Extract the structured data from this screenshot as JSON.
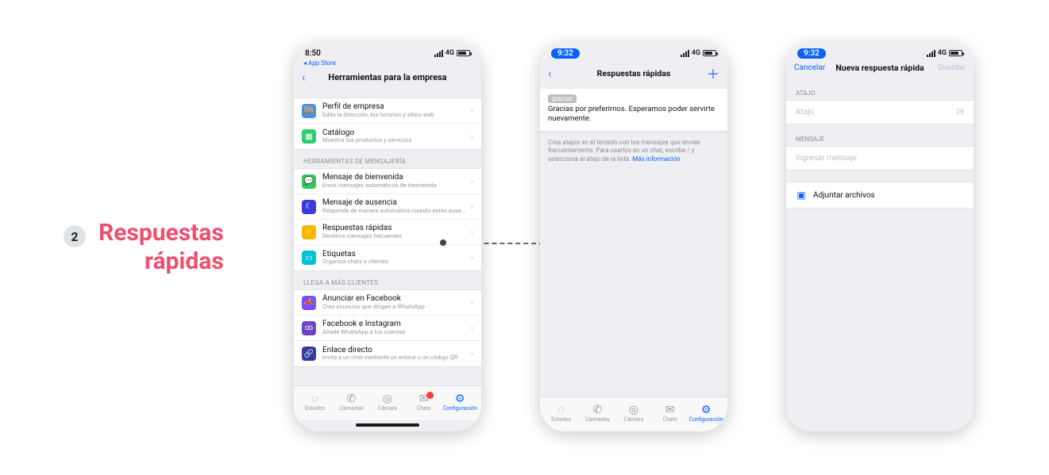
{
  "step": {
    "number": "2",
    "title_line1": "Respuestas",
    "title_line2": "rápidas"
  },
  "status": {
    "time_a": "8:50",
    "time_b": "9:32",
    "net": "4G"
  },
  "appstore_back": "App Store",
  "phone1": {
    "title": "Herramientas para la empresa",
    "groups": [
      {
        "header": "",
        "rows": [
          {
            "icon": "🏬",
            "iconbg": "#4a90e2",
            "title": "Perfil de empresa",
            "desc": "Edita la dirección, los horarios y sitios web"
          },
          {
            "icon": "▦",
            "iconbg": "#2ecc71",
            "title": "Catálogo",
            "desc": "Muestra tus productos y servicios"
          }
        ]
      },
      {
        "header": "HERRAMIENTAS DE MENSAJERÍA",
        "rows": [
          {
            "icon": "💬",
            "iconbg": "#34c759",
            "title": "Mensaje de bienvenida",
            "desc": "Envía mensajes automáticos de bienvenida"
          },
          {
            "icon": "☾",
            "iconbg": "#3b3bdc",
            "title": "Mensaje de ausencia",
            "desc": "Responde de manera automática cuando estés ausente"
          },
          {
            "icon": "⚡",
            "iconbg": "#f5b800",
            "title": "Respuestas rápidas",
            "desc": "Reutiliza mensajes frecuentes"
          },
          {
            "icon": "▭",
            "iconbg": "#00c2d1",
            "title": "Etiquetas",
            "desc": "Organiza chats y clientes"
          }
        ]
      },
      {
        "header": "LLEGA A MÁS CLIENTES",
        "rows": [
          {
            "icon": "📣",
            "iconbg": "#7b4dff",
            "title": "Anunciar en Facebook",
            "desc": "Crea anuncios que dirigen a WhatsApp"
          },
          {
            "icon": "∞",
            "iconbg": "#6b45c6",
            "title": "Facebook e Instagram",
            "desc": "Añade WhatsApp a tus cuentas"
          },
          {
            "icon": "🔗",
            "iconbg": "#3a3a9e",
            "title": "Enlace directo",
            "desc": "Invita a un chat mediante un enlace o un código QR"
          }
        ]
      }
    ]
  },
  "phone2": {
    "title": "Respuestas rápidas",
    "tag": "gracias",
    "message": "Gracias por preferirnos. Esperamos poder servirte nuevamente.",
    "hint_a": "Crea atajos en el teclado con los mensajes que envías frecuentemente. Para usarlos en un chat, escribe / y selecciona el atajo de la lista. ",
    "hint_link": "Más información"
  },
  "phone3": {
    "cancel": "Cancelar",
    "title": "Nueva respuesta rápida",
    "save": "Guardar",
    "section_shortcut": "ATAJO",
    "shortcut_placeholder": "Atajo",
    "shortcut_counter": "25",
    "section_message": "MENSAJE",
    "message_placeholder": "Ingresar mensaje",
    "attach": "Adjuntar archivos"
  },
  "tabs": [
    {
      "icon": "◌",
      "label": "Estados"
    },
    {
      "icon": "✆",
      "label": "Llamadas"
    },
    {
      "icon": "◎",
      "label": "Cámara"
    },
    {
      "icon": "✉",
      "label": "Chats",
      "badge": true
    },
    {
      "icon": "⚙",
      "label": "Configuración",
      "active": true
    }
  ]
}
